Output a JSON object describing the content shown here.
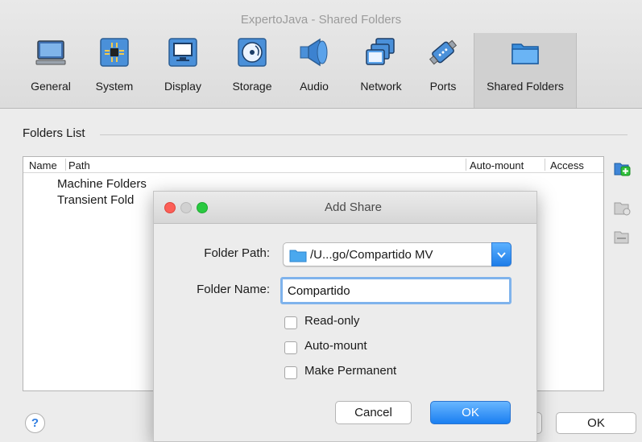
{
  "window": {
    "title": "ExpertoJava - Shared Folders"
  },
  "toolbar": {
    "items": [
      {
        "label": "General",
        "icon": "general-icon"
      },
      {
        "label": "System",
        "icon": "system-icon"
      },
      {
        "label": "Display",
        "icon": "display-icon"
      },
      {
        "label": "Storage",
        "icon": "storage-icon"
      },
      {
        "label": "Audio",
        "icon": "audio-icon"
      },
      {
        "label": "Network",
        "icon": "network-icon"
      },
      {
        "label": "Ports",
        "icon": "ports-icon"
      },
      {
        "label": "Shared Folders",
        "icon": "shared-folders-icon",
        "active": true
      }
    ]
  },
  "folders": {
    "section_title": "Folders List",
    "columns": [
      "Name",
      "Path",
      "Auto-mount",
      "Access"
    ],
    "rows": [
      "Machine Folders",
      "Transient Fold"
    ]
  },
  "bottom": {
    "help_label": "?",
    "ok_label": "OK"
  },
  "dialog": {
    "title": "Add Share",
    "folder_path_label": "Folder Path:",
    "folder_path_value": "/U...go/Compartido MV",
    "folder_name_label": "Folder Name:",
    "folder_name_value": "Compartido",
    "checkboxes": [
      {
        "label": "Read-only",
        "checked": false
      },
      {
        "label": "Auto-mount",
        "checked": false
      },
      {
        "label": "Make Permanent",
        "checked": false
      }
    ],
    "cancel_label": "Cancel",
    "ok_label": "OK"
  },
  "colors": {
    "accent": "#1a7ff1",
    "close": "#fc5f57",
    "minimize": "#d1d1d1",
    "zoom": "#29c940",
    "folder": "#4aa8ee"
  }
}
